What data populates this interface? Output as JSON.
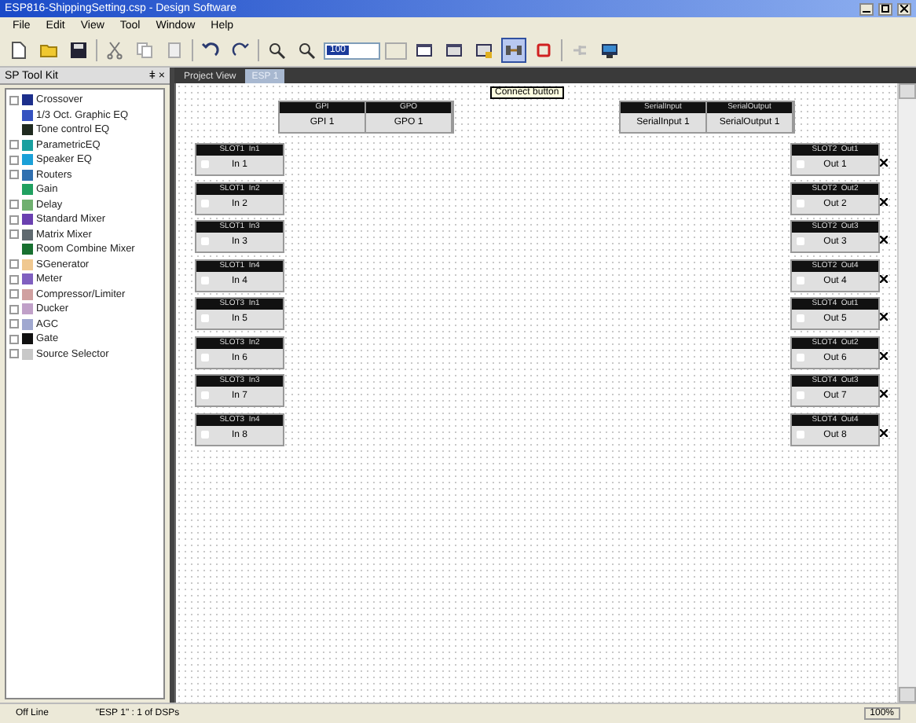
{
  "window": {
    "title": "ESP816-ShippingSetting.csp - Design Software"
  },
  "menu": [
    "File",
    "Edit",
    "View",
    "Tool",
    "Window",
    "Help"
  ],
  "toolbar": {
    "zoom_value": "100",
    "connect_selected": true,
    "tooltip": "Connect button"
  },
  "toolkit": {
    "title": "SP Tool Kit",
    "pin": "ǂ ×",
    "items": [
      {
        "label": "Crossover",
        "collapsed": true,
        "color": "#1c2f8c"
      },
      {
        "label": "1/3 Oct. Graphic EQ",
        "collapsed": false,
        "color": "#3552c0"
      },
      {
        "label": "Tone control EQ",
        "collapsed": false,
        "color": "#1f2a1f"
      },
      {
        "label": "ParametricEQ",
        "collapsed": true,
        "color": "#19a0a0"
      },
      {
        "label": "Speaker EQ",
        "collapsed": true,
        "color": "#1aa0d8"
      },
      {
        "label": "Routers",
        "collapsed": true,
        "color": "#3070b0"
      },
      {
        "label": "Gain",
        "collapsed": false,
        "color": "#20a060"
      },
      {
        "label": "Delay",
        "collapsed": true,
        "color": "#70b070"
      },
      {
        "label": "Standard Mixer",
        "collapsed": true,
        "color": "#6a40b0"
      },
      {
        "label": "Matrix Mixer",
        "collapsed": true,
        "color": "#606a70"
      },
      {
        "label": "Room Combine Mixer",
        "collapsed": false,
        "color": "#187030"
      },
      {
        "label": "SGenerator",
        "collapsed": true,
        "color": "#f0c890"
      },
      {
        "label": "Meter",
        "collapsed": true,
        "color": "#8060c0"
      },
      {
        "label": "Compressor/Limiter",
        "collapsed": true,
        "color": "#d0a0a0"
      },
      {
        "label": "Ducker",
        "collapsed": true,
        "color": "#c0a0c8"
      },
      {
        "label": "AGC",
        "collapsed": true,
        "color": "#a0a8d0"
      },
      {
        "label": "Gate",
        "collapsed": true,
        "color": "#101010"
      },
      {
        "label": "Source Selector",
        "collapsed": true,
        "color": "#c8c8c8"
      }
    ]
  },
  "tabs": [
    {
      "label": "Project View",
      "selected": false
    },
    {
      "label": "ESP 1",
      "selected": true
    }
  ],
  "io_groups": [
    {
      "headers": [
        "GPI",
        "GPO"
      ],
      "cells": [
        "GPI 1",
        "GPO 1"
      ]
    },
    {
      "headers": [
        "SerialInput",
        "SerialOutput"
      ],
      "cells": [
        "SerialInput 1",
        "SerialOutput 1"
      ]
    }
  ],
  "inputs": [
    {
      "header": "SLOT1  In1",
      "label": "In 1"
    },
    {
      "header": "SLOT1  In2",
      "label": "In 2"
    },
    {
      "header": "SLOT1  In3",
      "label": "In 3"
    },
    {
      "header": "SLOT1  In4",
      "label": "In 4"
    },
    {
      "header": "SLOT3  In1",
      "label": "In 5"
    },
    {
      "header": "SLOT3  In2",
      "label": "In 6"
    },
    {
      "header": "SLOT3  In3",
      "label": "In 7"
    },
    {
      "header": "SLOT3  In4",
      "label": "In 8"
    }
  ],
  "outputs": [
    {
      "header": "SLOT2  Out1",
      "label": "Out 1"
    },
    {
      "header": "SLOT2  Out2",
      "label": "Out 2"
    },
    {
      "header": "SLOT2  Out3",
      "label": "Out 3"
    },
    {
      "header": "SLOT2  Out4",
      "label": "Out 4"
    },
    {
      "header": "SLOT4  Out1",
      "label": "Out 5"
    },
    {
      "header": "SLOT4  Out2",
      "label": "Out 6"
    },
    {
      "header": "SLOT4  Out3",
      "label": "Out 7"
    },
    {
      "header": "SLOT4  Out4",
      "label": "Out 8"
    }
  ],
  "status_bar": {
    "mode": "Off Line",
    "device": "\"ESP 1\" : 1 of DSPs",
    "zoom": "100%"
  }
}
